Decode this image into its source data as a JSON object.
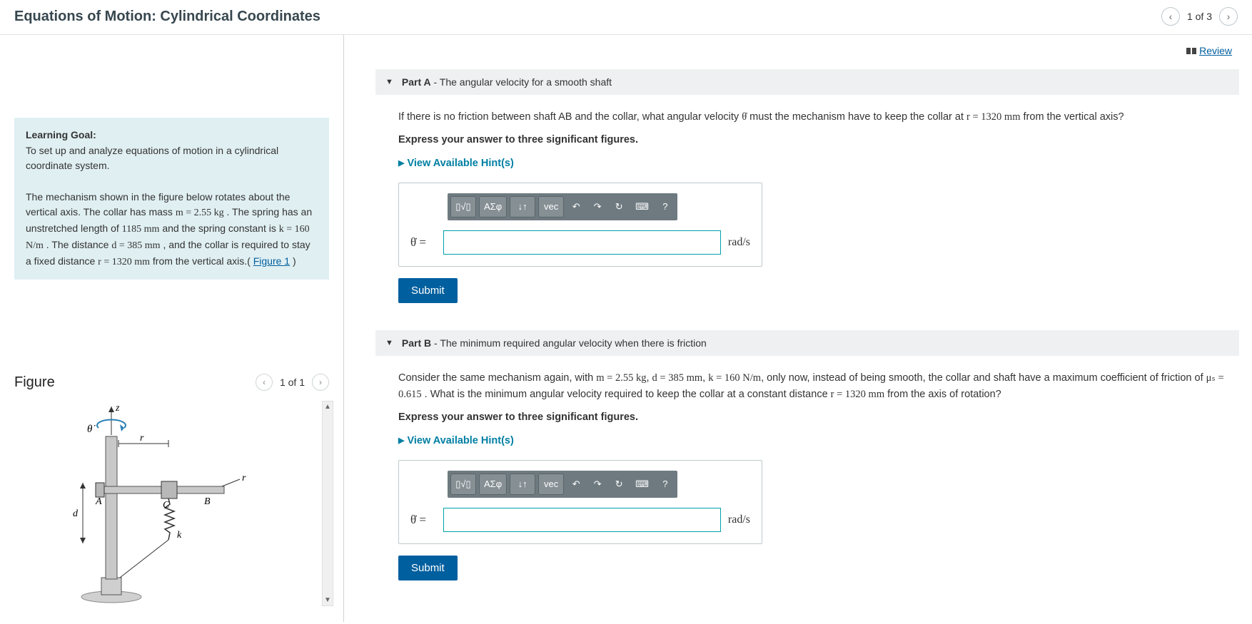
{
  "header": {
    "title": "Equations of Motion: Cylindrical Coordinates",
    "nav_counter": "1 of 3"
  },
  "review": {
    "label": "Review"
  },
  "learning_goal": {
    "heading": "Learning Goal:",
    "line1": "To set up and analyze equations of motion in a cylindrical coordinate system.",
    "line2a": "The mechanism shown in the figure below rotates about the vertical axis. The collar has mass ",
    "mass": "m = 2.55 kg",
    "line2b": ". The spring has an unstretched length of ",
    "unstretched": "1185 mm",
    "line2c": " and the spring constant is ",
    "k": "k = 160 N/m",
    "line2d": ". The distance ",
    "d": "d = 385 mm",
    "line2e": " , and the collar is required to stay a fixed distance ",
    "r": "r = 1320 mm",
    "line2f": " from the vertical axis.(",
    "figlink": "Figure 1",
    "line2g": ")"
  },
  "figure": {
    "title": "Figure",
    "counter": "1 of 1",
    "labels": {
      "z": "z",
      "theta": "θ̇",
      "r": "r",
      "A": "A",
      "B": "B",
      "C": "C",
      "d": "d",
      "k": "k",
      "rprime": "r"
    }
  },
  "partA": {
    "label": "Part A",
    "subtitle": " - The angular velocity for a smooth shaft",
    "q1": "If there is no friction between shaft AB and the collar, what angular velocity ",
    "qsym": "θ̇",
    "q2": " must the mechanism have to keep the collar at ",
    "qr": "r = 1320 mm",
    "q3": " from the vertical axis?",
    "express": "Express your answer to three significant figures.",
    "hints": "View Available Hint(s)",
    "answer_label": "θ̇ =",
    "units": "rad/s",
    "submit": "Submit"
  },
  "partB": {
    "label": "Part B",
    "subtitle": " - The minimum required angular velocity when there is friction",
    "q1": "Consider the same mechanism again, with ",
    "mass": "m = 2.55 kg",
    "d": "d = 385 mm",
    "k": "k = 160 N/m",
    "q2": ", only now, instead of being smooth, the collar and shaft have a maximum coefficient of friction of ",
    "mu": "μₛ = 0.615",
    "q3": " . What is the minimum angular velocity required to keep the collar at a constant distance ",
    "r": "r = 1320 mm",
    "q4": " from the axis of rotation?",
    "express": "Express your answer to three significant figures.",
    "hints": "View Available Hint(s)",
    "answer_label": "θ̇ =",
    "units": "rad/s",
    "submit": "Submit"
  },
  "toolbar": {
    "templates": "▯√▯",
    "greek": "ΑΣφ",
    "subscript": "↓↑",
    "vec": "vec",
    "undo": "↶",
    "redo": "↷",
    "reset": "↻",
    "keyboard": "⌨",
    "help": "?"
  }
}
